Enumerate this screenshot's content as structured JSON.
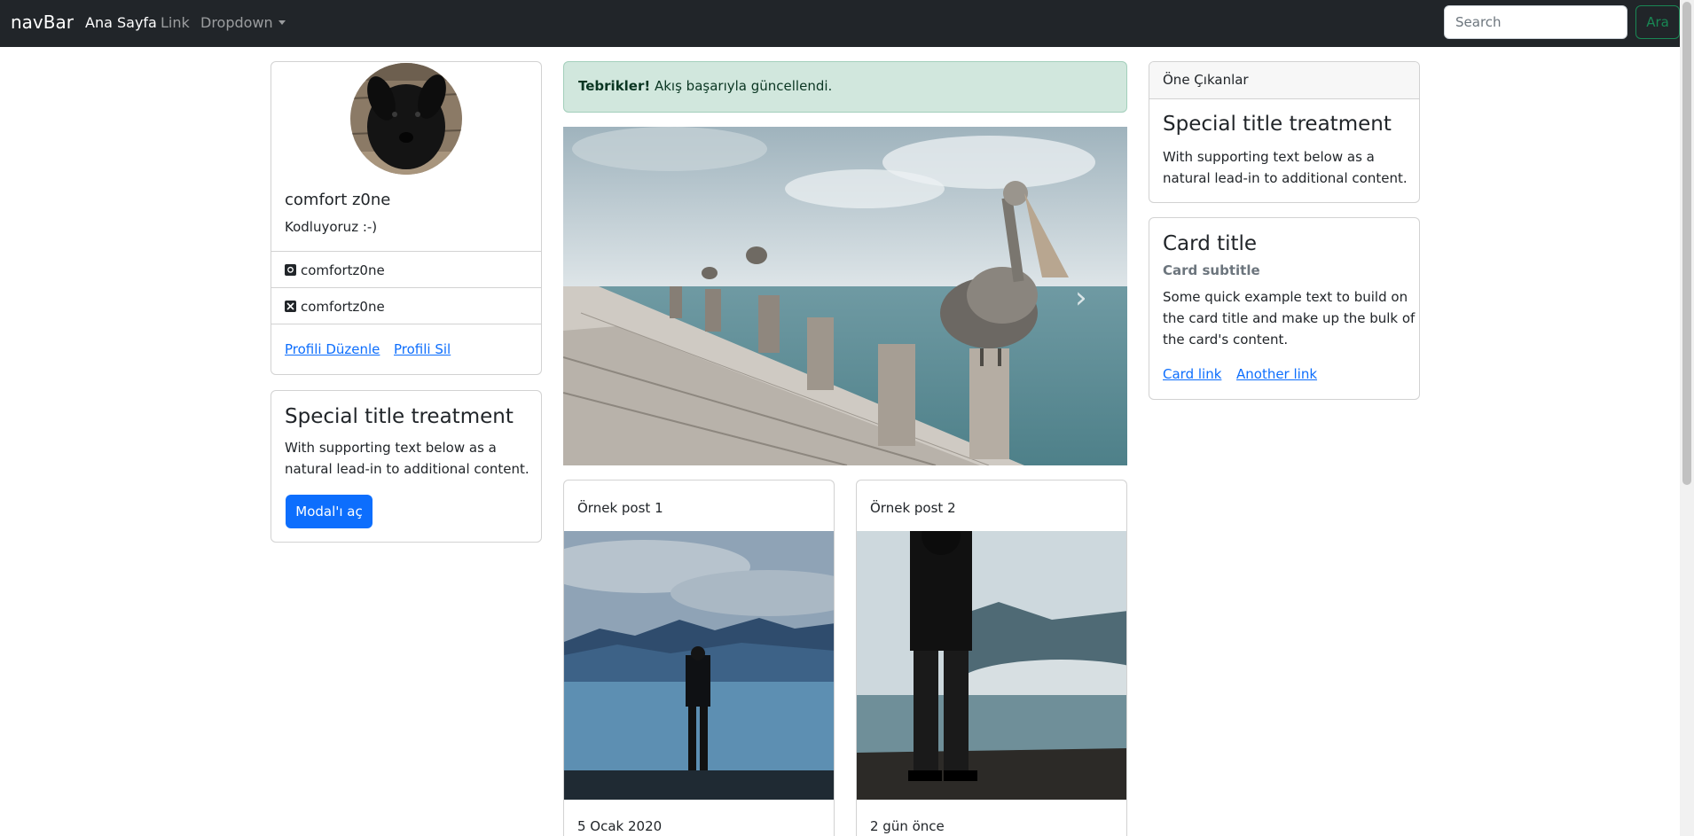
{
  "navbar": {
    "brand": "navBar",
    "links": [
      "Ana Sayfa",
      "Link",
      "Dropdown"
    ],
    "search_placeholder": "Search",
    "search_button": "Ara"
  },
  "profile": {
    "name": "comfort z0ne",
    "bio": "Kodluyoruz :-)",
    "github": "comfortz0ne",
    "x": "comfortz0ne",
    "edit_link": "Profili Düzenle",
    "delete_link": "Profili Sil"
  },
  "left_card": {
    "title": "Special title treatment",
    "text_line1": "With supporting text below as a",
    "text_line2": "natural lead-in to additional content.",
    "button": "Modal'ı aç"
  },
  "alert": {
    "strong": "Tebrikler!",
    "text": " Akış başarıyla güncellendi."
  },
  "carousel": {
    "next_icon": "chevron-right-icon"
  },
  "posts": [
    {
      "title": "Örnek post 1",
      "date": "5 Ocak 2020"
    },
    {
      "title": "Örnek post 2",
      "date": "2 gün önce"
    }
  ],
  "featured": {
    "header": "Öne Çıkanlar",
    "title": "Special title treatment",
    "text_line1": "With supporting text below as a",
    "text_line2": "natural lead-in to additional content."
  },
  "right_card": {
    "title": "Card title",
    "subtitle": "Card subtitle",
    "text_line1": "Some quick example text to build on",
    "text_line2": "the card title and make up the bulk of",
    "text_line3": "the card's content.",
    "link1": "Card link",
    "link2": "Another link"
  },
  "colors": {
    "navbar": "#212529",
    "primary": "#0d6efd",
    "success": "#198754",
    "alert_bg": "#d1e7dd"
  }
}
